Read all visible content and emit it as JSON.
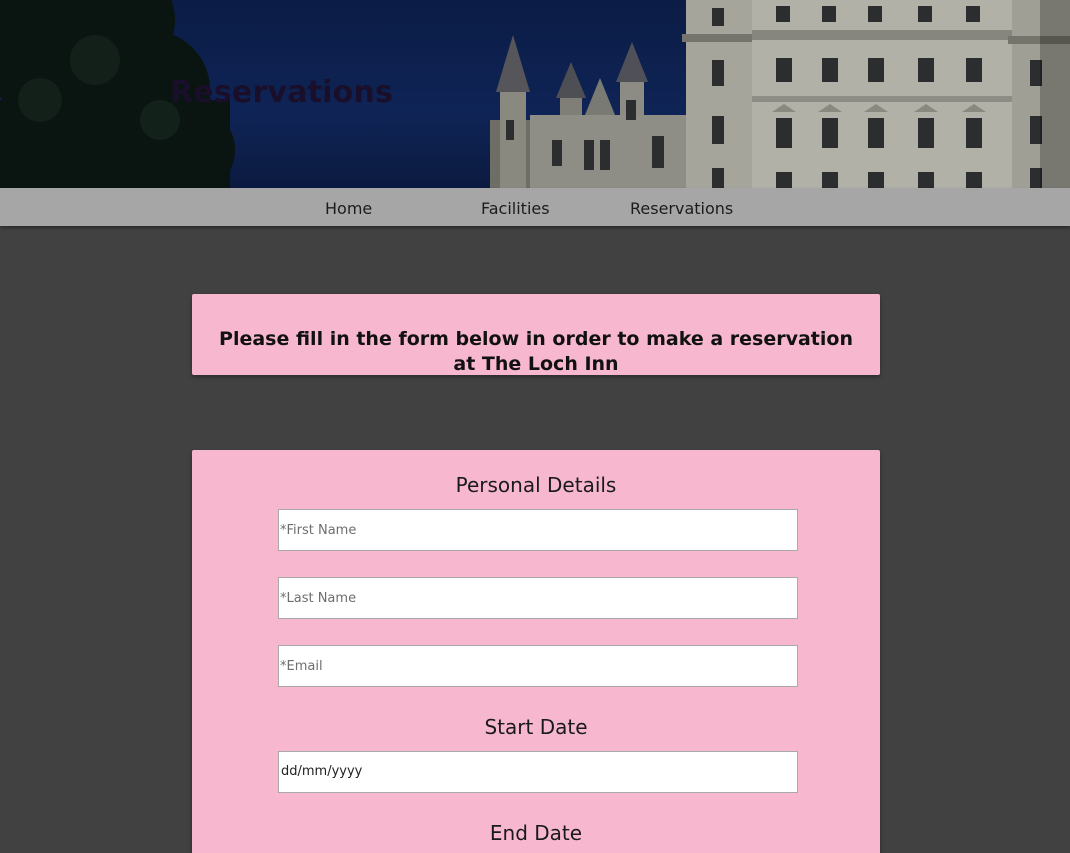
{
  "header": {
    "title": "Reservations"
  },
  "nav": {
    "items": [
      {
        "label": "Home"
      },
      {
        "label": "Facilities"
      },
      {
        "label": "Reservations"
      }
    ]
  },
  "notice": {
    "text": "Please fill in the form below in order to make a reservation at The Loch Inn"
  },
  "form": {
    "personal_heading": "Personal Details",
    "first_name_placeholder": "*First Name",
    "last_name_placeholder": "*Last Name",
    "email_placeholder": "*Email",
    "start_heading": "Start Date",
    "start_date_display": "dd/mm/yyyy",
    "end_heading": "End Date"
  },
  "colors": {
    "background": "#414141",
    "nav_bar": "#a6a6a6",
    "card": "#f7b8cf",
    "sky": "#0f2456"
  },
  "icons": {
    "banner_image": "castle-photo"
  }
}
